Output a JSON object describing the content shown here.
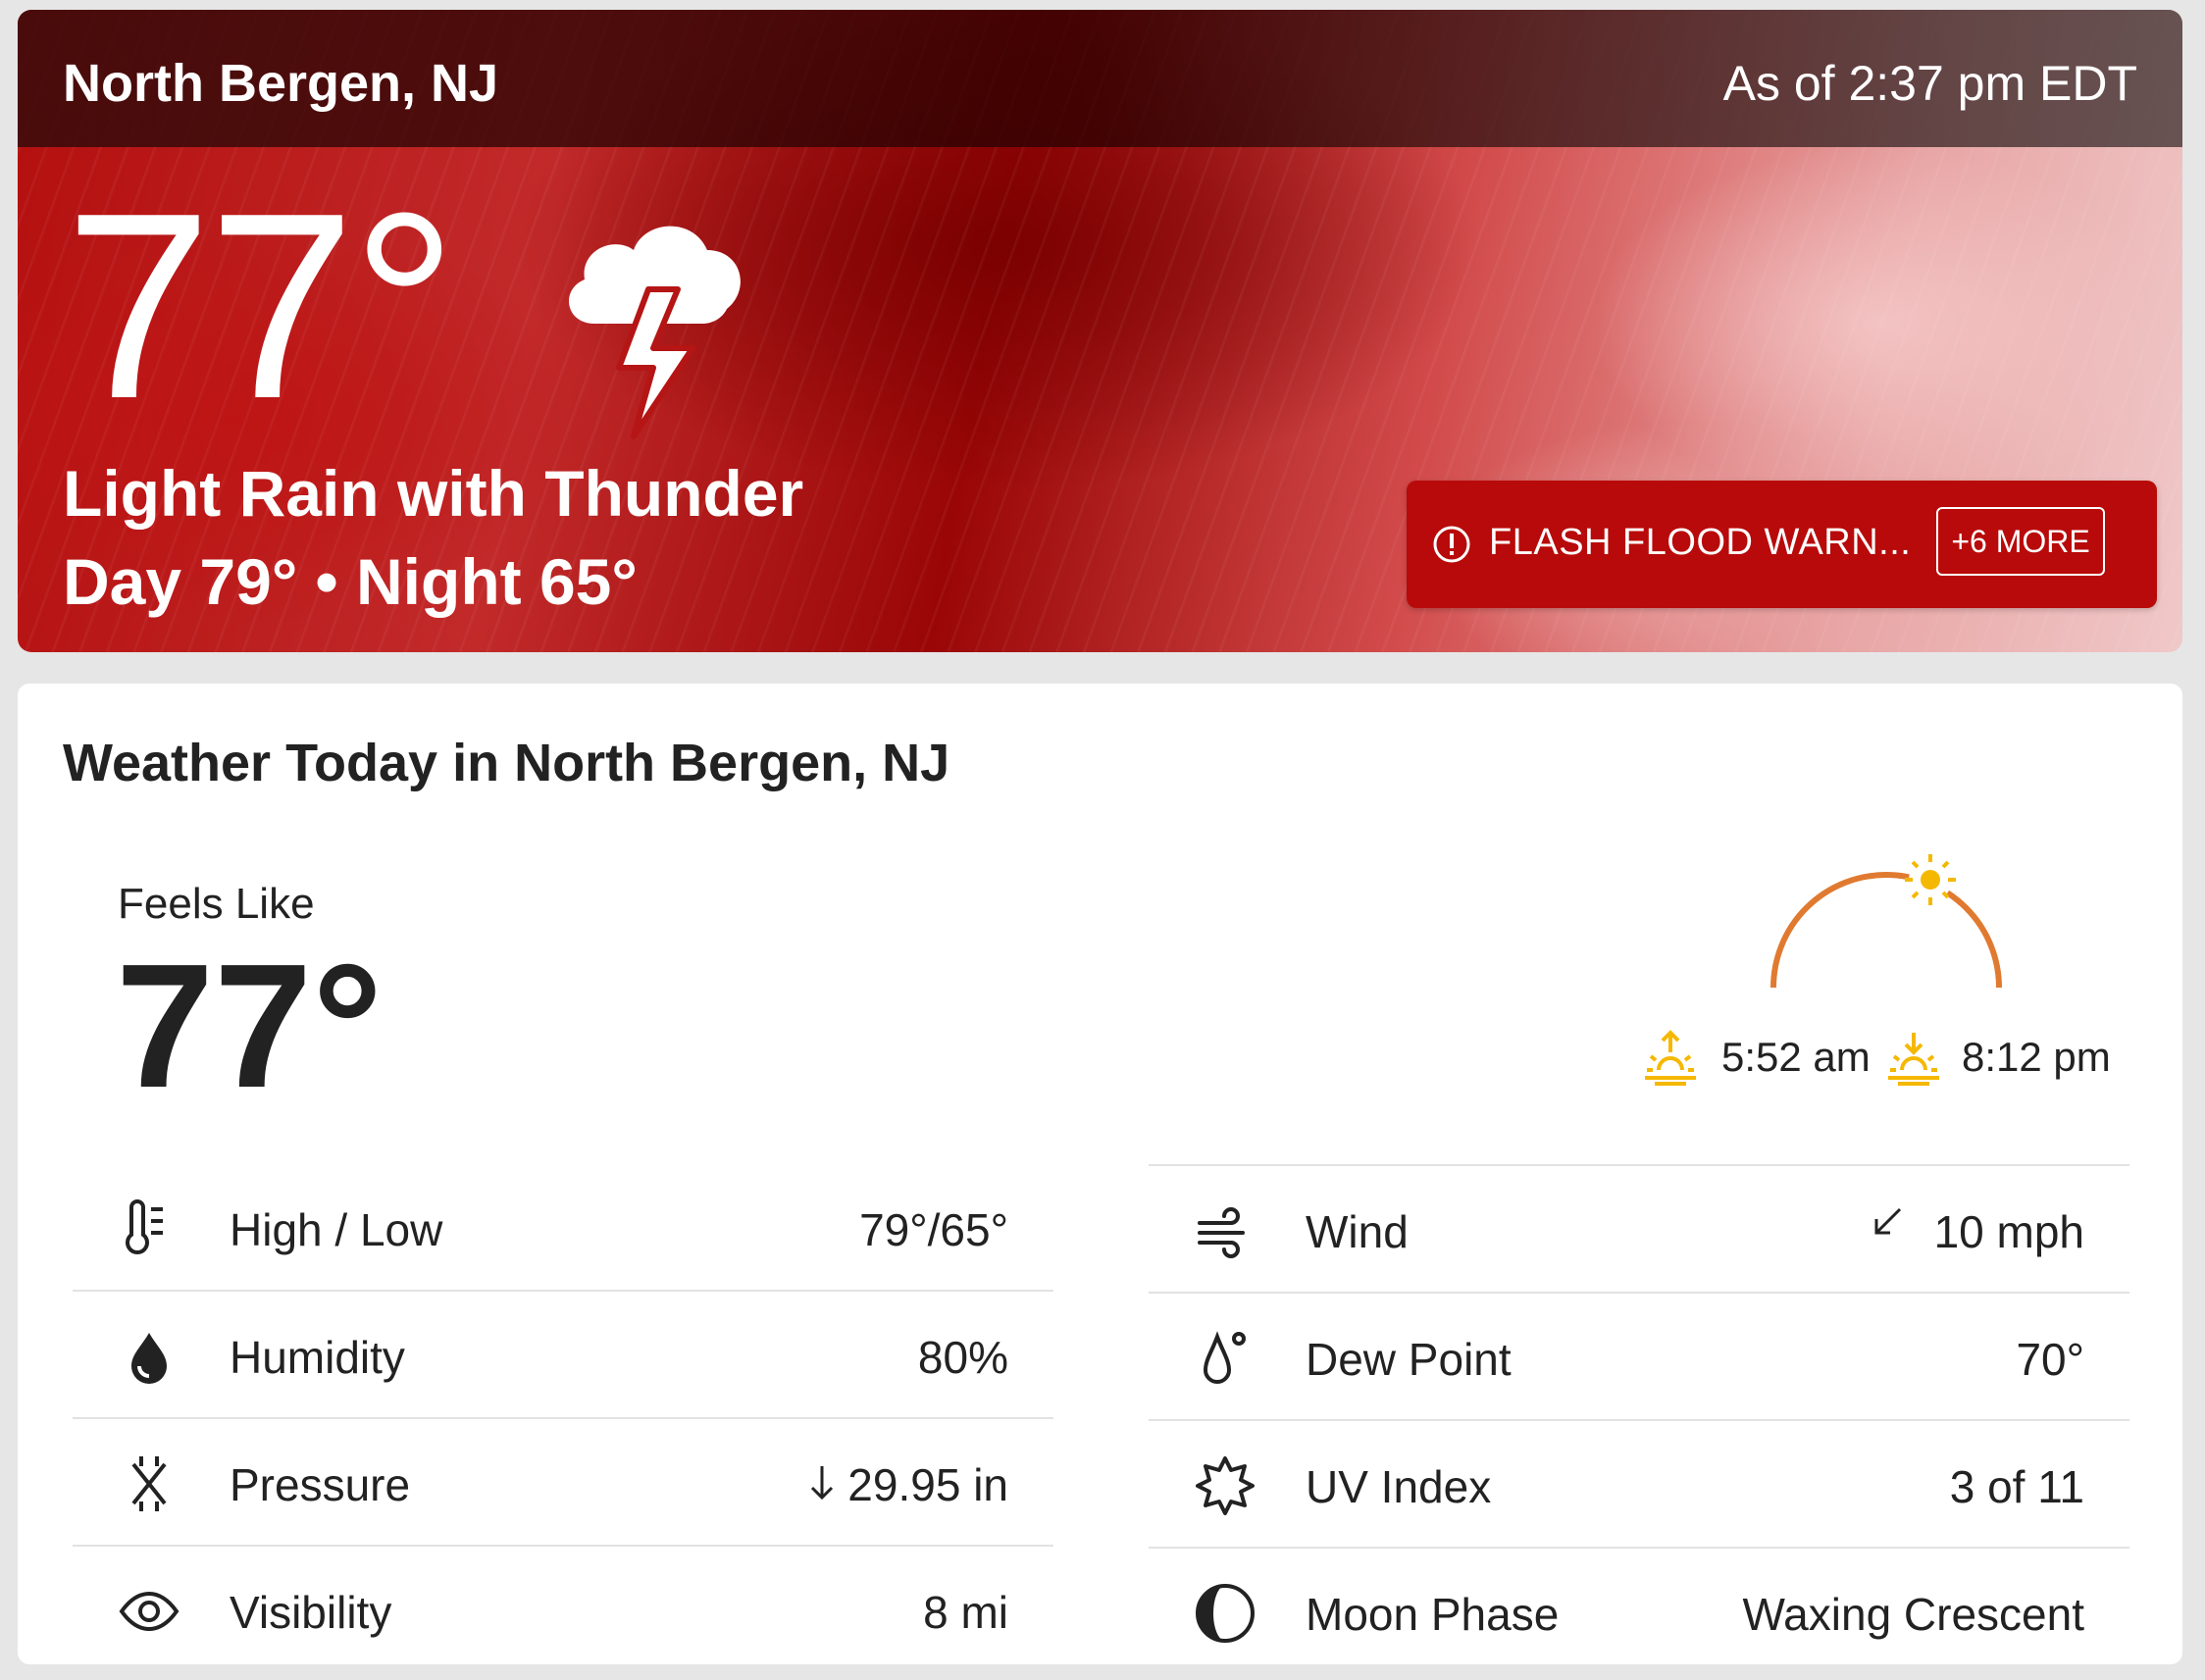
{
  "header": {
    "location": "North Bergen, NJ",
    "as_of": "As of 2:37 pm EDT"
  },
  "current": {
    "temperature": "77°",
    "condition_icon": "thunderstorm-icon",
    "phrase": "Light Rain with Thunder",
    "day_night": "Day 79° • Night 65°"
  },
  "alert": {
    "text": "FLASH FLOOD WARN...",
    "more": "+6 MORE",
    "color": "#b80a0a"
  },
  "today": {
    "title": "Weather Today in North Bergen, NJ",
    "feels_like_label": "Feels Like",
    "feels_like_value": "77°",
    "sunrise": "5:52 am",
    "sunset": "8:12 pm",
    "details_left": [
      {
        "icon": "thermometer-icon",
        "label": "High / Low",
        "value": "79°/65°"
      },
      {
        "icon": "humidity-drop-icon",
        "label": "Humidity",
        "value": "80%"
      },
      {
        "icon": "pressure-icon",
        "label": "Pressure",
        "value": "29.95 in",
        "trend": "down"
      },
      {
        "icon": "visibility-eye-icon",
        "label": "Visibility",
        "value": "8 mi"
      }
    ],
    "details_right": [
      {
        "icon": "wind-icon",
        "label": "Wind",
        "value": "10 mph",
        "direction": "southwest"
      },
      {
        "icon": "dew-point-icon",
        "label": "Dew Point",
        "value": "70°"
      },
      {
        "icon": "uv-index-icon",
        "label": "UV Index",
        "value": "3 of 11"
      },
      {
        "icon": "moon-phase-icon",
        "label": "Moon Phase",
        "value": "Waxing Crescent"
      }
    ]
  }
}
